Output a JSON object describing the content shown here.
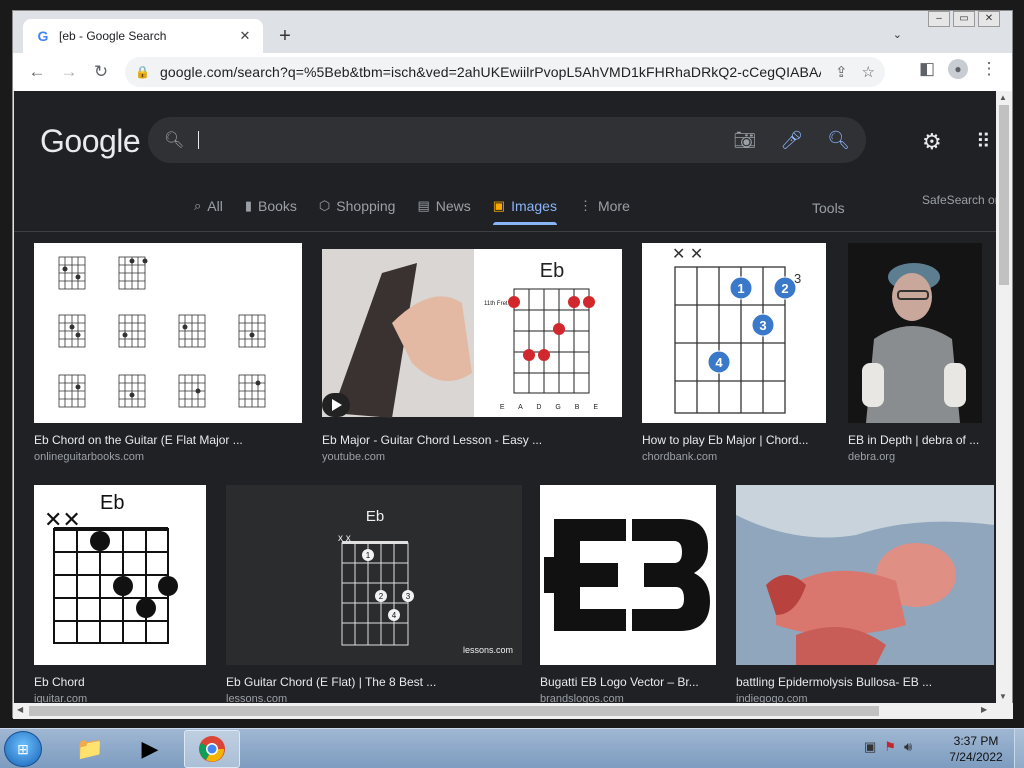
{
  "browser": {
    "tab_title": "[eb - Google Search",
    "tab_favicon": "G",
    "url": "google.com/search?q=%5Beb&tbm=isch&ved=2ahUKEwiilrPvopL5AhVMD1kFHRhaDRkQ2-cCegQIABAA&o..."
  },
  "google": {
    "logo": "Google",
    "search_value": "",
    "nav_tabs": [
      {
        "label": "All",
        "icon": "search-icon"
      },
      {
        "label": "Books",
        "icon": "book-icon"
      },
      {
        "label": "Shopping",
        "icon": "tag-icon"
      },
      {
        "label": "News",
        "icon": "news-icon"
      },
      {
        "label": "Images",
        "icon": "images-icon",
        "active": true
      },
      {
        "label": "More",
        "icon": "more-vert-icon"
      }
    ],
    "tools_label": "Tools",
    "safesearch_label": "SafeSearch on"
  },
  "results": [
    {
      "title": "Eb Chord on the Guitar (E Flat Major ...",
      "source": "onlineguitarbooks.com"
    },
    {
      "title": "Eb Major - Guitar Chord Lesson - Easy ...",
      "source": "youtube.com",
      "thumb_heading": "Eb",
      "fret_label": "11th Fret",
      "strings": "E A D G B E"
    },
    {
      "title": "How to play Eb Major | Chord...",
      "source": "chordbank.com"
    },
    {
      "title": "EB in Depth | debra of ...",
      "source": "debra.org"
    },
    {
      "title": "Eb Chord",
      "source": "iguitar.com",
      "thumb_heading": "Eb"
    },
    {
      "title": "Eb Guitar Chord (E Flat) | The 8 Best ...",
      "source": "lessons.com",
      "thumb_heading": "Eb",
      "watermark": "lessons.com"
    },
    {
      "title": "Bugatti EB Logo Vector – Br...",
      "source": "brandslogos.com"
    },
    {
      "title": "battling Epidermolysis Bullosa- EB ...",
      "source": "indiegogo.com"
    }
  ],
  "taskbar": {
    "time": "3:37 PM",
    "date": "7/24/2022"
  },
  "colors": {
    "page_bg": "#202124",
    "accent": "#8ab4f8",
    "chord_dot": "#3a78c9"
  }
}
